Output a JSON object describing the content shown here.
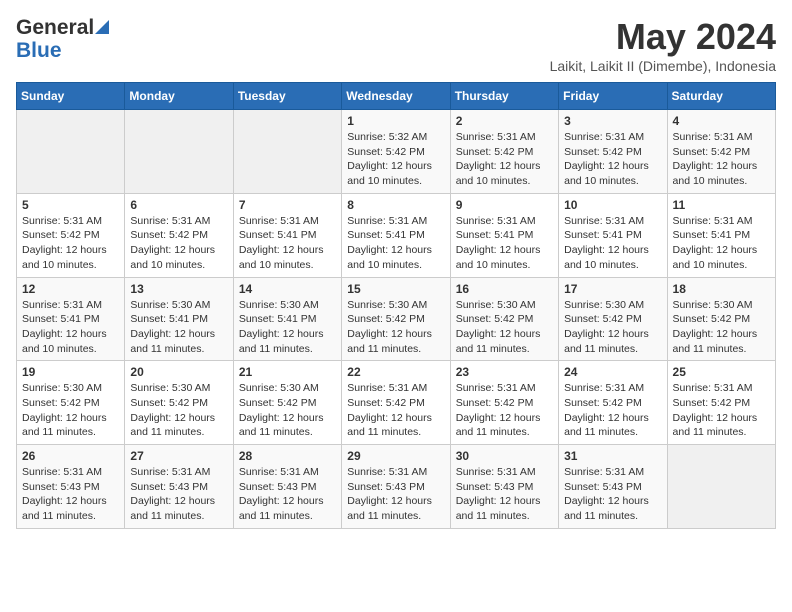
{
  "logo": {
    "line1": "General",
    "line2": "Blue"
  },
  "title": {
    "month_year": "May 2024",
    "location": "Laikit, Laikit II (Dimembe), Indonesia"
  },
  "weekdays": [
    "Sunday",
    "Monday",
    "Tuesday",
    "Wednesday",
    "Thursday",
    "Friday",
    "Saturday"
  ],
  "weeks": [
    [
      {
        "day": "",
        "info": ""
      },
      {
        "day": "",
        "info": ""
      },
      {
        "day": "",
        "info": ""
      },
      {
        "day": "1",
        "info": "Sunrise: 5:32 AM\nSunset: 5:42 PM\nDaylight: 12 hours\nand 10 minutes."
      },
      {
        "day": "2",
        "info": "Sunrise: 5:31 AM\nSunset: 5:42 PM\nDaylight: 12 hours\nand 10 minutes."
      },
      {
        "day": "3",
        "info": "Sunrise: 5:31 AM\nSunset: 5:42 PM\nDaylight: 12 hours\nand 10 minutes."
      },
      {
        "day": "4",
        "info": "Sunrise: 5:31 AM\nSunset: 5:42 PM\nDaylight: 12 hours\nand 10 minutes."
      }
    ],
    [
      {
        "day": "5",
        "info": "Sunrise: 5:31 AM\nSunset: 5:42 PM\nDaylight: 12 hours\nand 10 minutes."
      },
      {
        "day": "6",
        "info": "Sunrise: 5:31 AM\nSunset: 5:42 PM\nDaylight: 12 hours\nand 10 minutes."
      },
      {
        "day": "7",
        "info": "Sunrise: 5:31 AM\nSunset: 5:41 PM\nDaylight: 12 hours\nand 10 minutes."
      },
      {
        "day": "8",
        "info": "Sunrise: 5:31 AM\nSunset: 5:41 PM\nDaylight: 12 hours\nand 10 minutes."
      },
      {
        "day": "9",
        "info": "Sunrise: 5:31 AM\nSunset: 5:41 PM\nDaylight: 12 hours\nand 10 minutes."
      },
      {
        "day": "10",
        "info": "Sunrise: 5:31 AM\nSunset: 5:41 PM\nDaylight: 12 hours\nand 10 minutes."
      },
      {
        "day": "11",
        "info": "Sunrise: 5:31 AM\nSunset: 5:41 PM\nDaylight: 12 hours\nand 10 minutes."
      }
    ],
    [
      {
        "day": "12",
        "info": "Sunrise: 5:31 AM\nSunset: 5:41 PM\nDaylight: 12 hours\nand 10 minutes."
      },
      {
        "day": "13",
        "info": "Sunrise: 5:30 AM\nSunset: 5:41 PM\nDaylight: 12 hours\nand 11 minutes."
      },
      {
        "day": "14",
        "info": "Sunrise: 5:30 AM\nSunset: 5:41 PM\nDaylight: 12 hours\nand 11 minutes."
      },
      {
        "day": "15",
        "info": "Sunrise: 5:30 AM\nSunset: 5:42 PM\nDaylight: 12 hours\nand 11 minutes."
      },
      {
        "day": "16",
        "info": "Sunrise: 5:30 AM\nSunset: 5:42 PM\nDaylight: 12 hours\nand 11 minutes."
      },
      {
        "day": "17",
        "info": "Sunrise: 5:30 AM\nSunset: 5:42 PM\nDaylight: 12 hours\nand 11 minutes."
      },
      {
        "day": "18",
        "info": "Sunrise: 5:30 AM\nSunset: 5:42 PM\nDaylight: 12 hours\nand 11 minutes."
      }
    ],
    [
      {
        "day": "19",
        "info": "Sunrise: 5:30 AM\nSunset: 5:42 PM\nDaylight: 12 hours\nand 11 minutes."
      },
      {
        "day": "20",
        "info": "Sunrise: 5:30 AM\nSunset: 5:42 PM\nDaylight: 12 hours\nand 11 minutes."
      },
      {
        "day": "21",
        "info": "Sunrise: 5:30 AM\nSunset: 5:42 PM\nDaylight: 12 hours\nand 11 minutes."
      },
      {
        "day": "22",
        "info": "Sunrise: 5:31 AM\nSunset: 5:42 PM\nDaylight: 12 hours\nand 11 minutes."
      },
      {
        "day": "23",
        "info": "Sunrise: 5:31 AM\nSunset: 5:42 PM\nDaylight: 12 hours\nand 11 minutes."
      },
      {
        "day": "24",
        "info": "Sunrise: 5:31 AM\nSunset: 5:42 PM\nDaylight: 12 hours\nand 11 minutes."
      },
      {
        "day": "25",
        "info": "Sunrise: 5:31 AM\nSunset: 5:42 PM\nDaylight: 12 hours\nand 11 minutes."
      }
    ],
    [
      {
        "day": "26",
        "info": "Sunrise: 5:31 AM\nSunset: 5:43 PM\nDaylight: 12 hours\nand 11 minutes."
      },
      {
        "day": "27",
        "info": "Sunrise: 5:31 AM\nSunset: 5:43 PM\nDaylight: 12 hours\nand 11 minutes."
      },
      {
        "day": "28",
        "info": "Sunrise: 5:31 AM\nSunset: 5:43 PM\nDaylight: 12 hours\nand 11 minutes."
      },
      {
        "day": "29",
        "info": "Sunrise: 5:31 AM\nSunset: 5:43 PM\nDaylight: 12 hours\nand 11 minutes."
      },
      {
        "day": "30",
        "info": "Sunrise: 5:31 AM\nSunset: 5:43 PM\nDaylight: 12 hours\nand 11 minutes."
      },
      {
        "day": "31",
        "info": "Sunrise: 5:31 AM\nSunset: 5:43 PM\nDaylight: 12 hours\nand 11 minutes."
      },
      {
        "day": "",
        "info": ""
      }
    ]
  ]
}
